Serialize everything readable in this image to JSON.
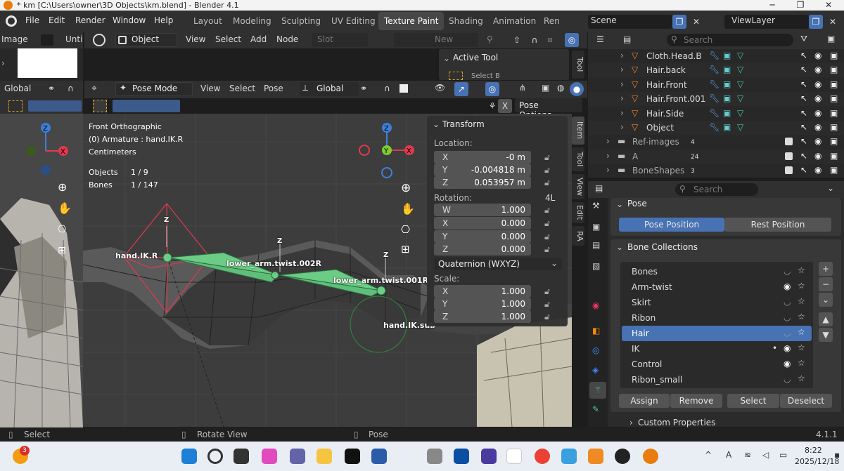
{
  "window": {
    "title": "* km [C:\\Users\\owner\\3D Objects\\km.blend] - Blender 4.1",
    "minimize": "─",
    "restore": "❐",
    "close": "✕"
  },
  "menu": [
    "File",
    "Edit",
    "Render",
    "Window",
    "Help"
  ],
  "workspaces": [
    "Layout",
    "Modeling",
    "Sculpting",
    "UV Editing",
    "Texture Paint",
    "Shading",
    "Animation",
    "Ren"
  ],
  "active_workspace": "Texture Paint",
  "scene": {
    "name": "Scene",
    "view_layer": "ViewLayer"
  },
  "image_editor": {
    "mode": "Image",
    "name": "Unti"
  },
  "paint_header": {
    "mode": "Object",
    "view": "View",
    "select": "Select",
    "add": "Add",
    "node": "Node",
    "slot": "Slot",
    "new": "New"
  },
  "active_tool_panel": {
    "title": "Active Tool",
    "item": "Select B"
  },
  "viewport_header": {
    "orientation": "Global",
    "mode": "Pose Mode",
    "view": "View",
    "select": "Select",
    "pose": "Pose",
    "transform_orientation": "Global"
  },
  "pose_options": "Pose Options",
  "viewport_info": {
    "view_name": "Front Orthographic",
    "context": "(0) Armature : hand.IK.R",
    "units": "Centimeters",
    "objects_label": "Objects",
    "objects_value": "1 / 9",
    "bones_label": "Bones",
    "bones_value": "1 / 147"
  },
  "gizmo_axes": {
    "x": "X",
    "y": "Y",
    "z": "Z"
  },
  "bone_labels": {
    "hand_ik": "hand.IK.R",
    "twist2": "lower_arm.twist.002R",
    "twist1": "lower_arm.twist.001R",
    "ik_sub": "hand.IK.sub",
    "z": "Z"
  },
  "transform": {
    "title": "Transform",
    "location_label": "Location:",
    "location": [
      {
        "axis": "X",
        "value": "-0 m"
      },
      {
        "axis": "Y",
        "value": "-0.004818 m"
      },
      {
        "axis": "Z",
        "value": "0.053957 m"
      }
    ],
    "rotation_label": "Rotation:",
    "rotation_badge": "4L",
    "rotation": [
      {
        "axis": "W",
        "value": "1.000"
      },
      {
        "axis": "X",
        "value": "0.000"
      },
      {
        "axis": "Y",
        "value": "0.000"
      },
      {
        "axis": "Z",
        "value": "0.000"
      }
    ],
    "rotation_mode": "Quaternion (WXYZ)",
    "scale_label": "Scale:",
    "scale": [
      {
        "axis": "X",
        "value": "1.000"
      },
      {
        "axis": "Y",
        "value": "1.000"
      },
      {
        "axis": "Z",
        "value": "1.000"
      }
    ]
  },
  "npanel_tabs": [
    "Item",
    "Tool",
    "View",
    "Edit",
    "RA"
  ],
  "outliner": {
    "search_placeholder": "Search",
    "rows": [
      {
        "name": "Cloth.Head.B",
        "count": ""
      },
      {
        "name": "Hair.back",
        "count": ""
      },
      {
        "name": "Hair.Front",
        "count": ""
      },
      {
        "name": "Hair.Front.001",
        "count": ""
      },
      {
        "name": "Hair.Side",
        "count": ""
      },
      {
        "name": "Object",
        "count": ""
      },
      {
        "name": "Ref-images",
        "count": "4"
      },
      {
        "name": "A",
        "count": "24"
      },
      {
        "name": "BoneShapes",
        "count": "3"
      }
    ]
  },
  "properties": {
    "search_placeholder": "Search",
    "pose_panel": "Pose",
    "pose_position": "Pose Position",
    "rest_position": "Rest Position",
    "bone_collections_panel": "Bone Collections",
    "collections": [
      "Bones",
      "Arm-twist",
      "Skirt",
      "Ribon",
      "Hair",
      "IK",
      "Control",
      "Ribon_small"
    ],
    "selected_collection": "Hair",
    "assign": "Assign",
    "remove": "Remove",
    "select": "Select",
    "deselect": "Deselect",
    "custom_properties": "Custom Properties"
  },
  "statusbar": {
    "left": "Select",
    "middle": "Rotate View",
    "right": "Pose",
    "version": "4.1.1"
  },
  "taskbar": {
    "time": "8:22",
    "date": "2025/12/18",
    "notification_count": "3",
    "ime": "A"
  },
  "colors": {
    "selection_blue": "#4772b3",
    "bone_green": "#5fbf7a",
    "gizmo_red": "#e0394f",
    "gizmo_green": "#7fcc2f",
    "gizmo_blue": "#3d7fdb"
  }
}
